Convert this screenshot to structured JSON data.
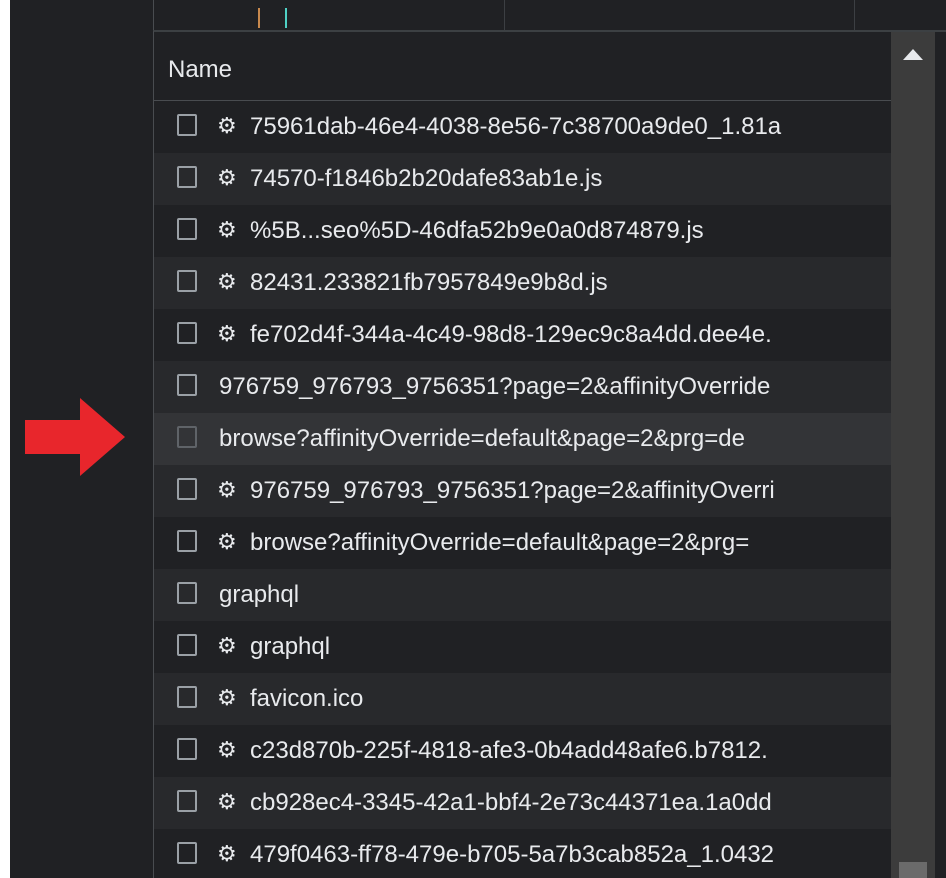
{
  "annotation": {
    "arrow_color": "#e8262c"
  },
  "timeline": {
    "marks": [
      {
        "color": "#c8894d"
      },
      {
        "color": "#4fd1c5"
      }
    ]
  },
  "table": {
    "column_header": "Name",
    "rows": [
      {
        "label": "75961dab-46e4-4038-8e56-7c38700a9de0_1.81a",
        "icon": "gear-icon",
        "has_icon": true
      },
      {
        "label": "74570-f1846b2b20dafe83ab1e.js",
        "icon": "gear-icon",
        "has_icon": true
      },
      {
        "label": "%5B...seo%5D-46dfa52b9e0a0d874879.js",
        "icon": "gear-icon",
        "has_icon": true
      },
      {
        "label": "82431.233821fb7957849e9b8d.js",
        "icon": "gear-icon",
        "has_icon": true
      },
      {
        "label": "fe702d4f-344a-4c49-98d8-129ec9c8a4dd.dee4e.",
        "icon": "gear-icon",
        "has_icon": true
      },
      {
        "label": "976759_976793_9756351?page=2&affinityOverride",
        "icon": null,
        "has_icon": false
      },
      {
        "label": "browse?affinityOverride=default&page=2&prg=de",
        "icon": null,
        "has_icon": false,
        "highlighted": true
      },
      {
        "label": "976759_976793_9756351?page=2&affinityOverri",
        "icon": "gear-icon",
        "has_icon": true
      },
      {
        "label": "browse?affinityOverride=default&page=2&prg=",
        "icon": "gear-icon",
        "has_icon": true
      },
      {
        "label": "graphql",
        "icon": null,
        "has_icon": false
      },
      {
        "label": "graphql",
        "icon": "gear-icon",
        "has_icon": true
      },
      {
        "label": "favicon.ico",
        "icon": "gear-icon",
        "has_icon": true
      },
      {
        "label": "c23d870b-225f-4818-afe3-0b4add48afe6.b7812.",
        "icon": "gear-icon",
        "has_icon": true
      },
      {
        "label": "cb928ec4-3345-42a1-bbf4-2e73c44371ea.1a0dd",
        "icon": "gear-icon",
        "has_icon": true
      },
      {
        "label": "479f0463-ff78-479e-b705-5a7b3cab852a_1.0432",
        "icon": "gear-icon",
        "has_icon": true
      }
    ]
  },
  "scrollbar": {
    "up_icon": "triangle-up-icon"
  }
}
